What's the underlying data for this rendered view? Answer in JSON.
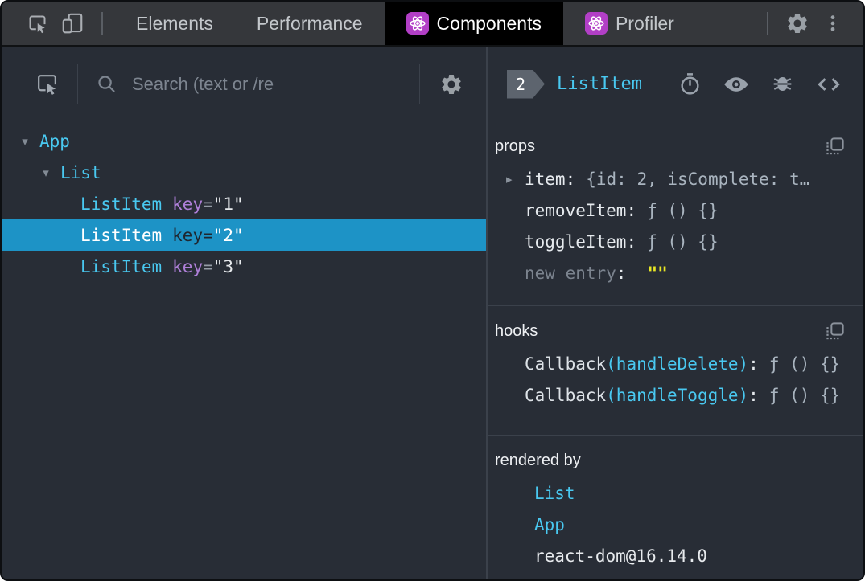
{
  "window_tabs": {
    "items": [
      {
        "label": "Elements"
      },
      {
        "label": "Performance"
      },
      {
        "label": "Components"
      },
      {
        "label": "Profiler"
      }
    ]
  },
  "left_panel": {
    "search_placeholder": "Search (text or /re",
    "tree": [
      {
        "name": "App",
        "expanded": true
      },
      {
        "name": "List",
        "expanded": true
      },
      {
        "name": "ListItem",
        "attr": "key",
        "value": "\"1\""
      },
      {
        "name": "ListItem",
        "attr": "key",
        "value": "\"2\"",
        "selected": true
      },
      {
        "name": "ListItem",
        "attr": "key",
        "value": "\"3\""
      }
    ]
  },
  "right_panel": {
    "header": {
      "badge": "2",
      "component": "ListItem"
    },
    "props": {
      "title": "props",
      "rows": [
        {
          "name": "item",
          "value": "{id: 2, isComplete: t…",
          "expandable": true
        },
        {
          "name": "removeItem",
          "value": "ƒ () {}"
        },
        {
          "name": "toggleItem",
          "value": "ƒ () {}"
        },
        {
          "name": "new entry",
          "value": "\"\""
        }
      ]
    },
    "hooks": {
      "title": "hooks",
      "rows": [
        {
          "name": "Callback",
          "paren": "(handleDelete)",
          "value": "ƒ () {}"
        },
        {
          "name": "Callback",
          "paren": "(handleToggle)",
          "value": "ƒ () {}"
        }
      ]
    },
    "rendered_by": {
      "title": "rendered by",
      "items": [
        {
          "label": "List"
        },
        {
          "label": "App"
        },
        {
          "label": "react-dom@16.14.0"
        }
      ]
    }
  },
  "symbols": {
    "eq": "=",
    "colon": ":",
    "expand_open": "▾",
    "expand_closed": "▸"
  },
  "colors": {
    "accent_cyan": "#49c8f0",
    "attr_purple": "#ae7fd8",
    "selected_row_blue": "#1d93c6",
    "new_entry_yellow": "#e8e625",
    "react_icon_purple": "#b23fc6",
    "panel_background": "#282d36",
    "tabbar_background": "#35373b"
  }
}
